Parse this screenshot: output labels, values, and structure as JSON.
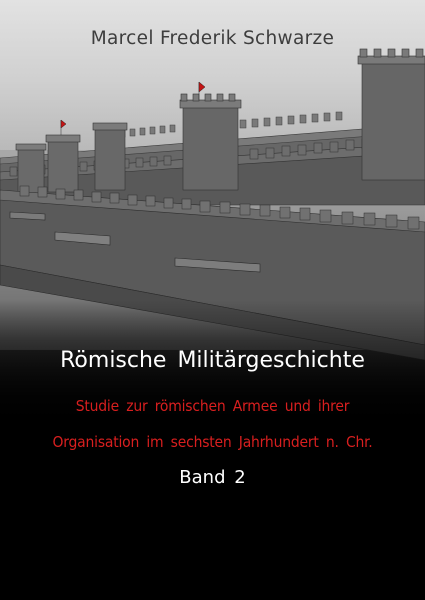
{
  "cover": {
    "author": "Marcel Frederik Schwarze",
    "title": "Römische Militärgeschichte",
    "subtitle_line1": "Studie zur römischen Armee und ihrer",
    "subtitle_line2": "Organisation im sechsten Jahrhundert n. Chr.",
    "volume": "Band 2"
  },
  "colors": {
    "subtitle": "#d81f1f",
    "title": "#ffffff",
    "author": "#3d3d3d",
    "flag": "#c41414"
  }
}
